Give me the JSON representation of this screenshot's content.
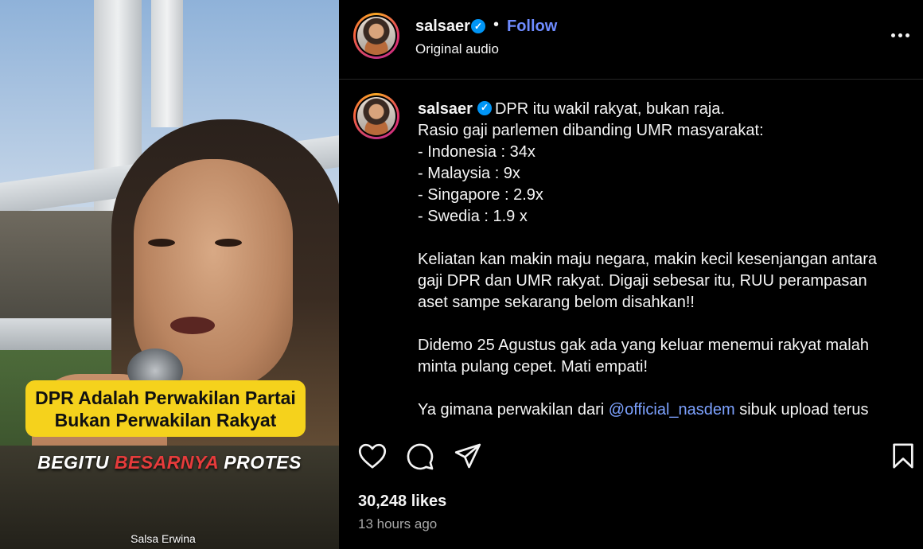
{
  "video": {
    "caption_line1": "DPR Adalah Perwakilan Partai",
    "caption_line2": "Bukan Perwakilan Rakyat",
    "headline_part1": "BEGITU ",
    "headline_accent": "BESARNYA",
    "headline_part2": " PROTES",
    "watermark": "Salsa Erwina",
    "headline_accent_color": "#e63b3b",
    "caption_box_color": "#f5d21c"
  },
  "header": {
    "username": "salsaer",
    "verified_icon": "verified-badge-icon",
    "separator": "•",
    "follow_label": "Follow",
    "audio_label": "Original audio",
    "more_icon": "more-options-icon"
  },
  "caption": {
    "username": "salsaer",
    "first_line": "DPR itu wakil rakyat, bukan raja.",
    "lines": [
      "Rasio gaji parlemen dibanding UMR masyarakat:",
      "- Indonesia : 34x",
      "- Malaysia : 9x",
      "- Singapore : 2.9x",
      "- Swedia : 1.9 x",
      "",
      "Keliatan kan makin maju negara, makin kecil kesenjangan antara",
      "gaji DPR dan UMR rakyat. Digaji sebesar itu, RUU perampasan",
      "aset sampe sekarang belom disahkan!!",
      "",
      "Didemo 25 Agustus gak ada yang keluar menemui rakyat malah",
      "minta pulang cepet. Mati empati!",
      ""
    ],
    "last_line_prefix": "Ya gimana perwakilan dari ",
    "mention": "@official_nasdem",
    "last_line_suffix": " sibuk upload terus"
  },
  "actions": {
    "like_icon": "heart-icon",
    "comment_icon": "comment-icon",
    "share_icon": "send-icon",
    "save_icon": "bookmark-icon"
  },
  "stats": {
    "likes": "30,248 likes",
    "time": "13 hours ago"
  },
  "colors": {
    "background": "#000000",
    "text": "#f5f5f5",
    "link": "#7da2ff",
    "follow": "#6e8bff",
    "verified": "#0095f6",
    "muted": "#a8a8a8"
  }
}
